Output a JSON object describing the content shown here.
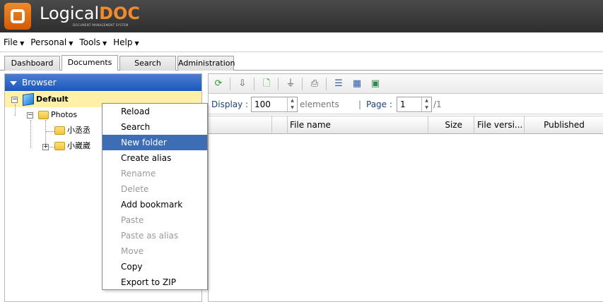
{
  "app": {
    "logo_main": "Logical",
    "logo_accent": "DOC",
    "logo_tagline": "DOCUMENT MANAGEMENT SYSTEM"
  },
  "menubar": {
    "items": [
      "File",
      "Personal",
      "Tools",
      "Help"
    ]
  },
  "tabs": [
    {
      "label": "Dashboard",
      "active": false
    },
    {
      "label": "Documents",
      "active": true
    },
    {
      "label": "Search",
      "active": false
    },
    {
      "label": "Administration",
      "active": false
    }
  ],
  "browser": {
    "title": "Browser",
    "tree": {
      "root": "Default",
      "children": [
        {
          "label": "Photos",
          "children": [
            {
              "label": "小丞丞"
            },
            {
              "label": "小崴崴"
            }
          ]
        }
      ]
    }
  },
  "pager": {
    "display_label": "Display :",
    "display_value": "100",
    "elements_label": "elements",
    "page_label": "Page :",
    "page_value": "1",
    "page_total": "/1"
  },
  "grid": {
    "columns": [
      "",
      "",
      "File name",
      "Size",
      "File versi...",
      "Published"
    ]
  },
  "context_menu": {
    "items": [
      {
        "label": "Reload",
        "enabled": true
      },
      {
        "label": "Search",
        "enabled": true
      },
      {
        "label": "New folder",
        "enabled": true,
        "highlighted": true
      },
      {
        "label": "Create alias",
        "enabled": true
      },
      {
        "label": "Rename",
        "enabled": false
      },
      {
        "label": "Delete",
        "enabled": false
      },
      {
        "label": "Add bookmark",
        "enabled": true
      },
      {
        "label": "Paste",
        "enabled": false
      },
      {
        "label": "Paste as alias",
        "enabled": false
      },
      {
        "label": "Move",
        "enabled": false
      },
      {
        "label": "Copy",
        "enabled": true
      },
      {
        "label": "Export to ZIP",
        "enabled": true
      }
    ]
  },
  "colors": {
    "header_bg": "#3a3a3a",
    "brand_orange": "#f08a2a",
    "browser_head": "#1c57bd",
    "selection": "#fff1a8",
    "menu_highlight": "#3d6db5"
  },
  "icons": {
    "toolbar": [
      "refresh-icon",
      "download-icon",
      "add-document-icon",
      "filter-icon",
      "print-icon",
      "list-view-icon",
      "grid-view-icon",
      "preview-icon"
    ]
  }
}
